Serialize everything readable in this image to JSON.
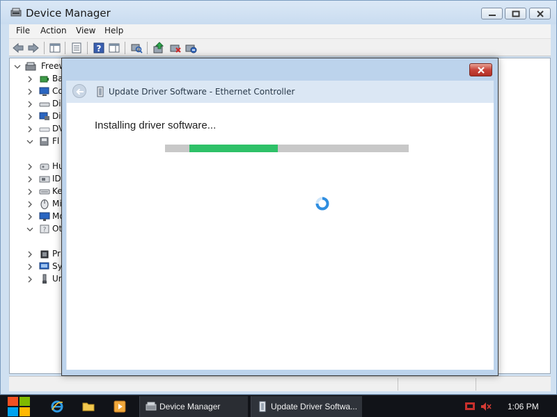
{
  "window": {
    "title": "Device Manager",
    "title_icon": "device-manager-icon"
  },
  "menu": [
    "File",
    "Action",
    "View",
    "Help"
  ],
  "toolbar": {
    "icons": [
      "back-arrow-icon",
      "forward-arrow-icon",
      "show-hide-console-tree-icon",
      "properties-list-icon",
      "help-icon",
      "action-pane-icon",
      "scan-hardware-icon",
      "update-driver-icon",
      "disable-device-icon",
      "uninstall-device-icon"
    ]
  },
  "tree": {
    "root": "Freew",
    "items": [
      {
        "label": "Ba",
        "icon": "batteries-icon",
        "expanded": false
      },
      {
        "label": "Co",
        "icon": "computer-icon",
        "expanded": false
      },
      {
        "label": "Di",
        "icon": "disk-drive-icon",
        "expanded": false
      },
      {
        "label": "Di",
        "icon": "display-adapter-icon",
        "expanded": false
      },
      {
        "label": "DV",
        "icon": "dvd-drive-icon",
        "expanded": false
      },
      {
        "label": "Fl",
        "icon": "floppy-controller-icon",
        "expanded": true
      },
      {
        "label": "",
        "icon": "warning-device-icon",
        "child": true
      },
      {
        "label": "Hu",
        "icon": "hid-icon",
        "expanded": false
      },
      {
        "label": "ID",
        "icon": "ide-controller-icon",
        "expanded": false
      },
      {
        "label": "Ke",
        "icon": "keyboard-icon",
        "expanded": false
      },
      {
        "label": "Mi",
        "icon": "mouse-icon",
        "expanded": false
      },
      {
        "label": "Mo",
        "icon": "monitor-icon",
        "expanded": false
      },
      {
        "label": "Ot",
        "icon": "other-devices-icon",
        "expanded": true
      },
      {
        "label": "",
        "icon": "warning-device-icon",
        "child": true
      },
      {
        "label": "Pr",
        "icon": "processor-icon",
        "expanded": false
      },
      {
        "label": "Sy",
        "icon": "system-devices-icon",
        "expanded": false
      },
      {
        "label": "Ur",
        "icon": "usb-controller-icon",
        "expanded": false
      }
    ]
  },
  "dialog": {
    "title": "Update Driver Software - Ethernet Controller",
    "status": "Installing driver software...",
    "progress": {
      "start": 0.1,
      "end": 0.463
    },
    "colors": {
      "progress": "#2ec168",
      "track": "#c8c8c8",
      "spinner": "#2f8ee0"
    }
  },
  "taskbar": {
    "pinned": [
      "internet-explorer-icon",
      "file-explorer-icon",
      "media-player-icon"
    ],
    "tasks": [
      {
        "label": "Device Manager",
        "icon": "device-manager-icon"
      },
      {
        "label": "Update Driver Softwa...",
        "icon": "driver-update-icon"
      }
    ],
    "tray": [
      "action-center-flag-icon",
      "volume-muted-icon"
    ],
    "clock": "1:06 PM"
  }
}
